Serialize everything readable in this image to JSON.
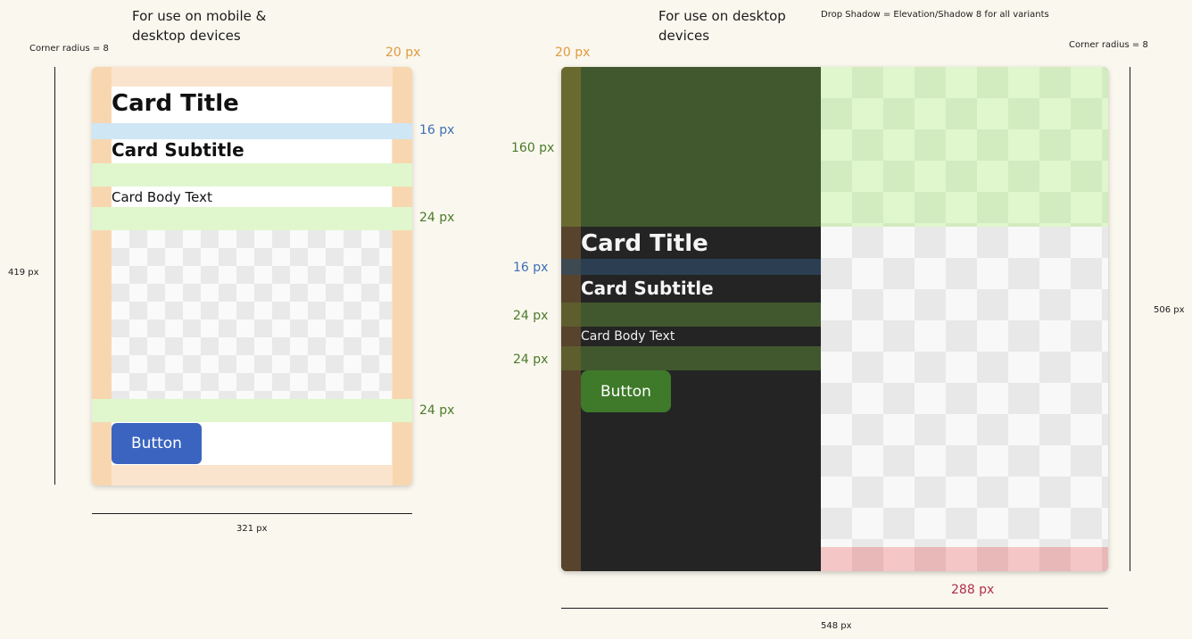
{
  "header": {
    "mobile_note": "For use on mobile & desktop devices",
    "desktop_note": "For use on desktop devices",
    "shadow_note": "Drop Shadow = Elevation/Shadow 8 for all variants"
  },
  "mobile": {
    "corner_radius": "Corner radius = 8",
    "padding_label": "20 px",
    "gap_title_subtitle": "16 px",
    "gap_body": "24 px",
    "gap_button": "24 px",
    "height_label": "419 px",
    "width_label": "321 px",
    "card": {
      "title": "Card Title",
      "subtitle": "Card Subtitle",
      "body": "Card Body Text",
      "button": "Button"
    }
  },
  "desktop": {
    "corner_radius": "Corner radius = 8",
    "padding_label": "20 px",
    "image_height": "160 px",
    "gap_title_subtitle": "16 px",
    "gap_subtitle_body": "24 px",
    "gap_body_button": "24 px",
    "height_label": "506 px",
    "image_width": "288 px",
    "width_label": "548 px",
    "card": {
      "title": "Card Title",
      "subtitle": "Card Subtitle",
      "body": "Card Body Text",
      "button": "Button"
    }
  },
  "colors": {
    "padding_overlay": "#fbe4cd",
    "gap_blue": "#cfe6f5",
    "gap_green": "#e0f7cd",
    "button_blue": "#3a64c0",
    "button_green": "#3e7a2a",
    "dark_surface": "#242424",
    "image_overlay_red": "#f4c6c6"
  }
}
